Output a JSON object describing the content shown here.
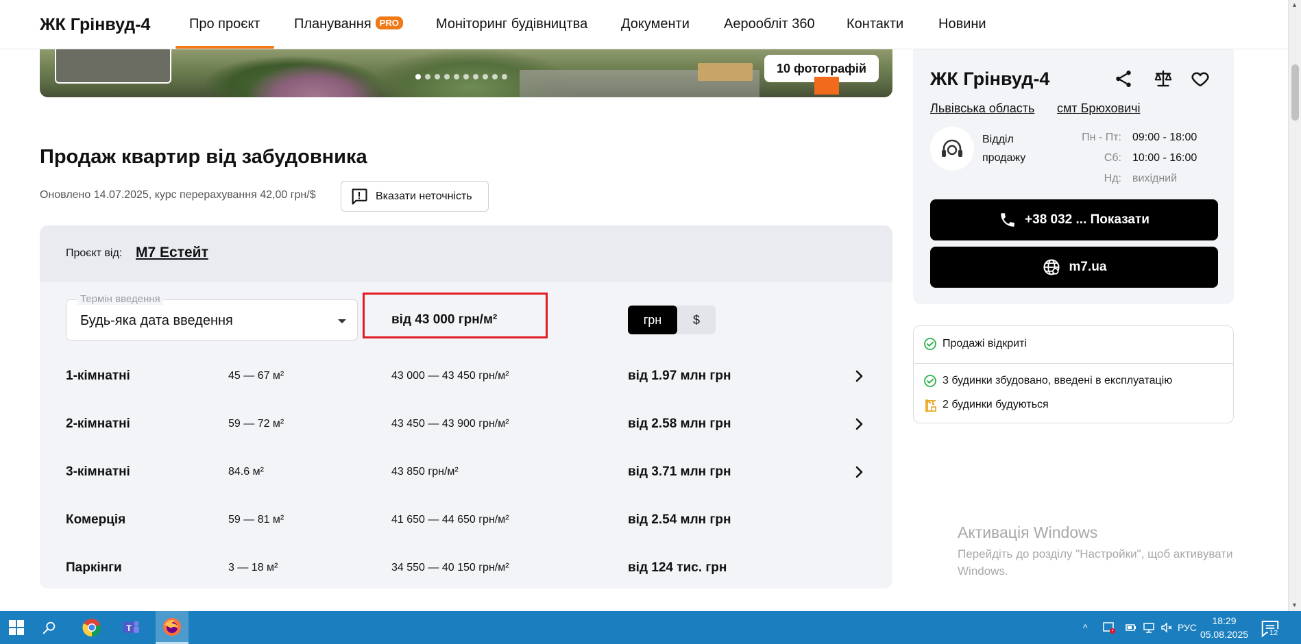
{
  "nav": {
    "logo": "ЖК Грінвуд-4",
    "items": [
      "Про проєкт",
      "Планування",
      "Моніторинг будівництва",
      "Документи",
      "Аерооблiт 360",
      "Контакти",
      "Новини"
    ],
    "pro_badge": "PRO"
  },
  "hero": {
    "photo_count": "10 фотографій",
    "slides_total": 10,
    "current_slide": 1
  },
  "section": {
    "title": "Продаж квартир від забудовника",
    "updated": "Оновлено 14.07.2025, курс перерахування 42,00 грн/$",
    "report_button": "Вказати неточність"
  },
  "project": {
    "by_label": "Проєкт від:",
    "developer": "M7 Естейт",
    "filter": {
      "legend": "Термін введення",
      "value": "Будь-яка дата введення"
    },
    "price_from": "від 43 000 грн/м²",
    "currency": {
      "active": "грн",
      "inactive": "$"
    },
    "rows": [
      {
        "type": "1-кімнатні",
        "area": "45 — 67 м²",
        "price_m2": "43 000 — 43 450 грн/м²",
        "total": "від 1.97 млн грн",
        "has_link": true
      },
      {
        "type": "2-кімнатні",
        "area": "59 — 72 м²",
        "price_m2": "43 450 — 43 900 грн/м²",
        "total": "від 2.58 млн грн",
        "has_link": true
      },
      {
        "type": "3-кімнатні",
        "area": "84.6 м²",
        "price_m2": "43 850 грн/м²",
        "total": "від 3.71 млн грн",
        "has_link": true
      },
      {
        "type": "Комерція",
        "area": "59 — 81 м²",
        "price_m2": "41 650 — 44 650 грн/м²",
        "total": "від 2.54 млн грн",
        "has_link": false
      },
      {
        "type": "Паркінги",
        "area": "3 — 18 м²",
        "price_m2": "34 550 — 40 150 грн/м²",
        "total": "від 124 тис. грн",
        "has_link": false
      }
    ]
  },
  "sidebar": {
    "title": "ЖК Грінвуд-4",
    "region": "Львівська область",
    "town": "смт Брюховичі",
    "dept": "Відділ продажу",
    "schedule": [
      {
        "days": "Пн - Пт:",
        "hours": "09:00 - 18:00"
      },
      {
        "days": "Сб:",
        "hours": "10:00 - 16:00"
      },
      {
        "days": "Нд:",
        "hours": "вихідний"
      }
    ],
    "phone_button": "+38 032 ... Показати",
    "site_button": "m7.ua",
    "status": {
      "sales": "Продажі відкриті",
      "built": "3 будинки збудовано, введені в експлуатацію",
      "building": "2 будинки будуються"
    }
  },
  "watermark": {
    "title": "Активація Windows",
    "subtitle": "Перейдіть до розділу \"Настройки\", щоб активувати Windows."
  },
  "taskbar": {
    "lang": "РУС",
    "time": "18:29",
    "date": "05.08.2025",
    "notifications": "12"
  },
  "colors": {
    "accent": "#f07a1a",
    "highlight_box": "#e01b24",
    "button_bg": "#000000",
    "panel_bg": "#f3f4f7",
    "taskbar": "#1b7fbf",
    "check": "#2bb24c"
  }
}
